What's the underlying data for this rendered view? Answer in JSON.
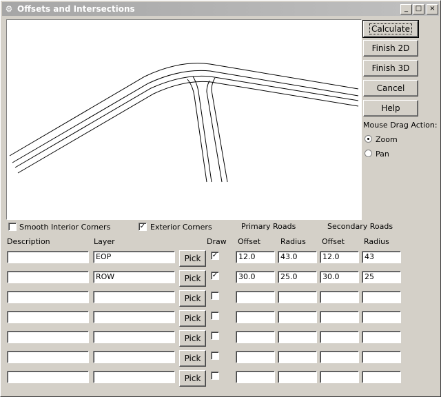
{
  "window": {
    "title": "Offsets and Intersections",
    "icon": "app-icon"
  },
  "titlebar_buttons": {
    "minimize": "_",
    "maximize": "□",
    "close": "×"
  },
  "buttons": {
    "calculate": "Calculate",
    "finish2d": "Finish 2D",
    "finish3d": "Finish 3D",
    "cancel": "Cancel",
    "help": "Help"
  },
  "mouse_drag": {
    "label": "Mouse Drag Action:",
    "zoom": "Zoom",
    "pan": "Pan",
    "selected": "zoom"
  },
  "options": {
    "smooth_interior": "Smooth Interior Corners",
    "smooth_checked": false,
    "exterior": "Exterior Corners",
    "exterior_checked": true
  },
  "group_headers": {
    "primary": "Primary Roads",
    "secondary": "Secondary Roads"
  },
  "columns": {
    "description": "Description",
    "layer": "Layer",
    "draw": "Draw",
    "p_offset": "Offset",
    "p_radius": "Radius",
    "s_offset": "Offset",
    "s_radius": "Radius"
  },
  "pick_label": "Pick",
  "rows": [
    {
      "description": "",
      "layer": "EOP",
      "draw": true,
      "p_offset": "12.0",
      "p_radius": "43.0",
      "s_offset": "12.0",
      "s_radius": "43"
    },
    {
      "description": "",
      "layer": "ROW",
      "draw": true,
      "p_offset": "30.0",
      "p_radius": "25.0",
      "s_offset": "30.0",
      "s_radius": "25"
    },
    {
      "description": "",
      "layer": "",
      "draw": false,
      "p_offset": "",
      "p_radius": "",
      "s_offset": "",
      "s_radius": ""
    },
    {
      "description": "",
      "layer": "",
      "draw": false,
      "p_offset": "",
      "p_radius": "",
      "s_offset": "",
      "s_radius": ""
    },
    {
      "description": "",
      "layer": "",
      "draw": false,
      "p_offset": "",
      "p_radius": "",
      "s_offset": "",
      "s_radius": ""
    },
    {
      "description": "",
      "layer": "",
      "draw": false,
      "p_offset": "",
      "p_radius": "",
      "s_offset": "",
      "s_radius": ""
    },
    {
      "description": "",
      "layer": "",
      "draw": false,
      "p_offset": "",
      "p_radius": "",
      "s_offset": "",
      "s_radius": ""
    }
  ]
}
